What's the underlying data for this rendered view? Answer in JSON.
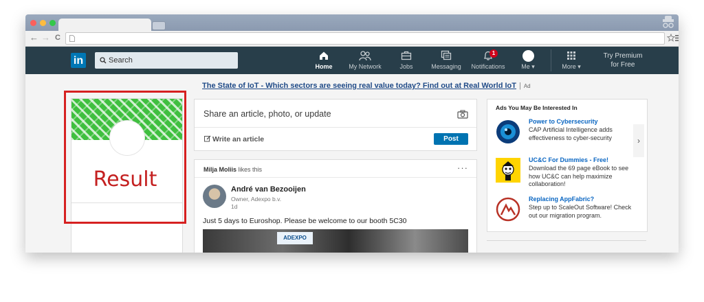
{
  "browser": {
    "controls": {
      "close_color": "#fc605c",
      "minimize_color": "#fdbc40",
      "maximize_color": "#34c84a"
    },
    "nav": {
      "back": "←",
      "forward": "→",
      "reload": "C"
    }
  },
  "header": {
    "logo_text": "in",
    "search_placeholder": "Search",
    "nav_items": [
      {
        "label": "Home",
        "icon": "home-icon",
        "active": true
      },
      {
        "label": "My Network",
        "icon": "network-icon"
      },
      {
        "label": "Jobs",
        "icon": "briefcase-icon"
      },
      {
        "label": "Messaging",
        "icon": "messaging-icon"
      },
      {
        "label": "Notifications",
        "icon": "bell-icon",
        "badge": "1"
      },
      {
        "label": "Me ▾",
        "icon": "avatar"
      },
      {
        "label": "More ▾",
        "icon": "grid-icon"
      }
    ],
    "premium_line1": "Try Premium",
    "premium_line2": "for Free"
  },
  "ad_banner": {
    "link_text": "The State of IoT - Which sectors are seeing real value today? Find out at Real World IoT",
    "separator": "|",
    "ad_label": "Ad"
  },
  "profile_card": {
    "overlay_text": "Result",
    "highlight_color": "#d62020"
  },
  "share_box": {
    "prompt": "Share an article, photo, or update",
    "write_article": "Write an article",
    "post_button": "Post"
  },
  "feed": {
    "liker_name": "Milja Moliis",
    "liker_action": " likes this",
    "more": "···",
    "author_name": "André van Bezooijen",
    "author_role": "Owner, Adexpo b.v.",
    "post_time": "1d",
    "post_text": "Just 5 days to Euroshop. Please be welcome to our booth 5C30",
    "image_sign": "ADEXPO"
  },
  "ads": {
    "title": "Ads You May Be Interested In",
    "arrow": "›",
    "items": [
      {
        "name": "Power to Cybersecurity",
        "desc": "CAP Artificial Intelligence adds effectiveness to cyber-security",
        "logo": "eye-logo"
      },
      {
        "name": "UC&C For Dummies - Free!",
        "desc": "Download the 69 page eBook to see how UC&C can help maximize collaboration!",
        "logo": "dummies-logo"
      },
      {
        "name": "Replacing AppFabric?",
        "desc": "Step up to ScaleOut Software! Check out our migration program.",
        "logo": "scaleout-logo"
      }
    ]
  }
}
